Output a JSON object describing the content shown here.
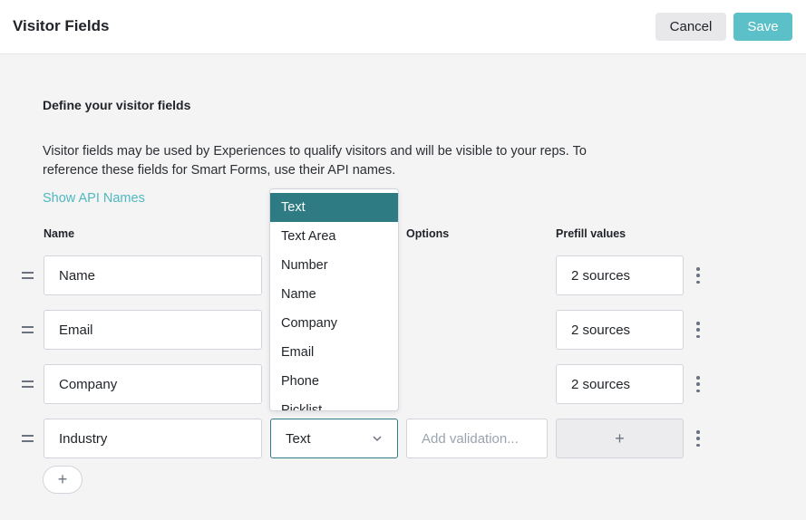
{
  "header": {
    "title": "Visitor Fields",
    "cancel_label": "Cancel",
    "save_label": "Save"
  },
  "section": {
    "title": "Define your visitor fields",
    "description": "Visitor fields may be used by Experiences to qualify visitors and will be visible to your reps. To reference these fields for Smart Forms, use their API names.",
    "show_api_names": "Show API Names"
  },
  "columns": {
    "name": "Name",
    "options": "Options",
    "prefill": "Prefill values"
  },
  "rows": [
    {
      "name": "Name",
      "prefill": "2 sources"
    },
    {
      "name": "Email",
      "prefill": "2 sources"
    },
    {
      "name": "Company",
      "prefill": "2 sources"
    },
    {
      "name": "Industry",
      "type": "Text",
      "validation_placeholder": "Add validation...",
      "prefill_add": "+"
    }
  ],
  "add_row_label": "+",
  "type_dropdown": {
    "selected": "Text",
    "options": [
      "Text",
      "Text Area",
      "Number",
      "Name",
      "Company",
      "Email",
      "Phone",
      "Picklist"
    ]
  },
  "colors": {
    "accent": "#5bc0c7",
    "selected_option": "#2e7b84"
  }
}
